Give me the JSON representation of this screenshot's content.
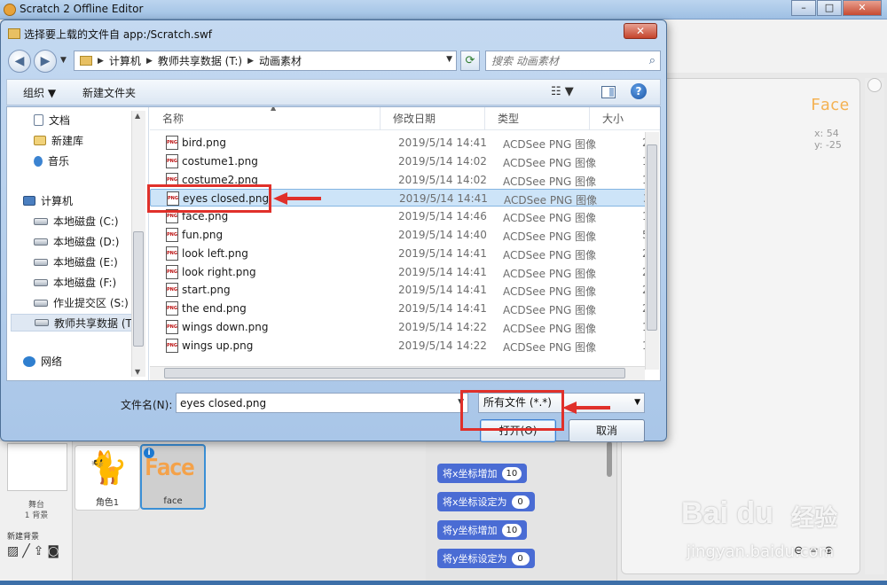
{
  "background_app": {
    "title": "Scratch 2 Offline Editor",
    "stage": {
      "sprite_name": "Face",
      "x_readout": "x: 54",
      "y_readout": "y: -25"
    },
    "stage_panel": {
      "label": "舞台",
      "sub_label": "1 背景",
      "new_backdrop_label": "新建背景"
    },
    "sprites": [
      {
        "name": "角色1",
        "selected": false
      },
      {
        "name": "face",
        "selected": true
      }
    ],
    "blocks": [
      {
        "label": "将x坐标增加",
        "value": "10"
      },
      {
        "label": "将x坐标设定为",
        "value": "0"
      },
      {
        "label": "将y坐标增加",
        "value": "10"
      },
      {
        "label": "将y坐标设定为",
        "value": "0"
      }
    ],
    "colors": {
      "block_blue": "#4a6cd4",
      "sprite_name_orange": "#f4b253",
      "selection_blue": "#3a8fd6"
    }
  },
  "dialog": {
    "title": "选择要上载的文件自 app:/Scratch.swf",
    "breadcrumb": [
      "计算机",
      "教师共享数据 (T:)",
      "动画素材"
    ],
    "search_placeholder": "搜索 动画素材",
    "toolbar": {
      "organize": "组织 ▼",
      "new_folder": "新建文件夹"
    },
    "nav_pane": [
      {
        "label": "文档",
        "icon": "document-icon"
      },
      {
        "label": "新建库",
        "icon": "library-icon"
      },
      {
        "label": "音乐",
        "icon": "music-icon"
      },
      {
        "label": "计算机",
        "icon": "computer-icon"
      },
      {
        "label": "本地磁盘 (C:)",
        "icon": "drive-icon"
      },
      {
        "label": "本地磁盘 (D:)",
        "icon": "drive-icon"
      },
      {
        "label": "本地磁盘 (E:)",
        "icon": "drive-icon"
      },
      {
        "label": "本地磁盘 (F:)",
        "icon": "drive-icon"
      },
      {
        "label": "作业提交区 (S:)",
        "icon": "network-drive-icon"
      },
      {
        "label": "教师共享数据 (T:",
        "icon": "network-drive-icon"
      },
      {
        "label": "网络",
        "icon": "network-icon"
      }
    ],
    "columns": {
      "name": "名称",
      "date": "修改日期",
      "type": "类型",
      "size": "大小"
    },
    "files": [
      {
        "name": "bird.png",
        "date": "2019/5/14 14:41",
        "type": "ACDSee PNG 图像",
        "size": "2"
      },
      {
        "name": "costume1.png",
        "date": "2019/5/14 14:02",
        "type": "ACDSee PNG 图像",
        "size": "1"
      },
      {
        "name": "costume2.png",
        "date": "2019/5/14 14:02",
        "type": "ACDSee PNG 图像",
        "size": "1"
      },
      {
        "name": "eyes closed.png",
        "date": "2019/5/14 14:41",
        "type": "ACDSee PNG 图像",
        "size": "3",
        "selected": true
      },
      {
        "name": "face.png",
        "date": "2019/5/14 14:46",
        "type": "ACDSee PNG 图像",
        "size": "1"
      },
      {
        "name": "fun.png",
        "date": "2019/5/14 14:40",
        "type": "ACDSee PNG 图像",
        "size": "5"
      },
      {
        "name": "look left.png",
        "date": "2019/5/14 14:41",
        "type": "ACDSee PNG 图像",
        "size": "2"
      },
      {
        "name": "look right.png",
        "date": "2019/5/14 14:41",
        "type": "ACDSee PNG 图像",
        "size": "2"
      },
      {
        "name": "start.png",
        "date": "2019/5/14 14:41",
        "type": "ACDSee PNG 图像",
        "size": "2"
      },
      {
        "name": "the end.png",
        "date": "2019/5/14 14:41",
        "type": "ACDSee PNG 图像",
        "size": "2"
      },
      {
        "name": "wings down.png",
        "date": "2019/5/14 14:22",
        "type": "ACDSee PNG 图像",
        "size": "1"
      },
      {
        "name": "wings up.png",
        "date": "2019/5/14 14:22",
        "type": "ACDSee PNG 图像",
        "size": "1"
      }
    ],
    "filename_label": "文件名(N):",
    "filename_value": "eyes closed.png",
    "filter_value": "所有文件 (*.*)",
    "open_button": "打开(O)",
    "cancel_button": "取消",
    "png_badge": "PNG"
  },
  "watermark": {
    "logo": "Bai du",
    "cn": "经验",
    "url": "jingyan.baidu.com"
  },
  "annotation_color": "#e0302a"
}
